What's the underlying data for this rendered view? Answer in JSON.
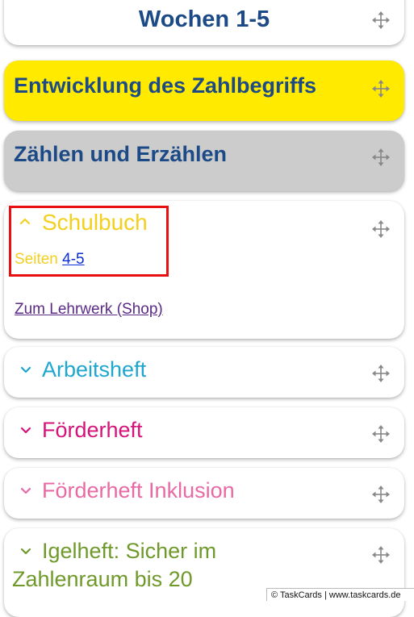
{
  "cards": {
    "wochen": {
      "title": "Wochen 1-5"
    },
    "entwicklung": {
      "title": "Entwicklung des Zahlbegriffs"
    },
    "zaehlen": {
      "title": "Zählen und Erzählen"
    },
    "schulbuch": {
      "title": "Schulbuch",
      "pages_label": "Seiten",
      "pages_link": "4-5",
      "shop_link": "Zum Lehrwerk (Shop)"
    },
    "arbeitsheft": {
      "title": "Arbeitsheft"
    },
    "foerderheft": {
      "title": "Förderheft"
    },
    "inklusion": {
      "title": "Förderheft Inklusion"
    },
    "igelheft": {
      "title_line1": "Igelheft: Sicher im",
      "title_line2": "Zahlenraum bis 20"
    }
  },
  "footer": {
    "text": "© TaskCards | www.taskcards.de"
  },
  "colors": {
    "heading_blue": "#1c4a86",
    "yellow_card": "#ffea00",
    "gray_card": "#cccccc",
    "schulbuch_yellow": "#f3cf1e",
    "arbeitsheft_cyan": "#1ea6cf",
    "foerderheft_magenta": "#d4147a",
    "inklusion_pink": "#e86aa4",
    "igelheft_green": "#6f9a2b",
    "highlight_red": "#e81010"
  },
  "icons": {
    "move": "move-arrows-icon",
    "expand": "chevron-down-icon",
    "collapse": "chevron-up-icon"
  }
}
